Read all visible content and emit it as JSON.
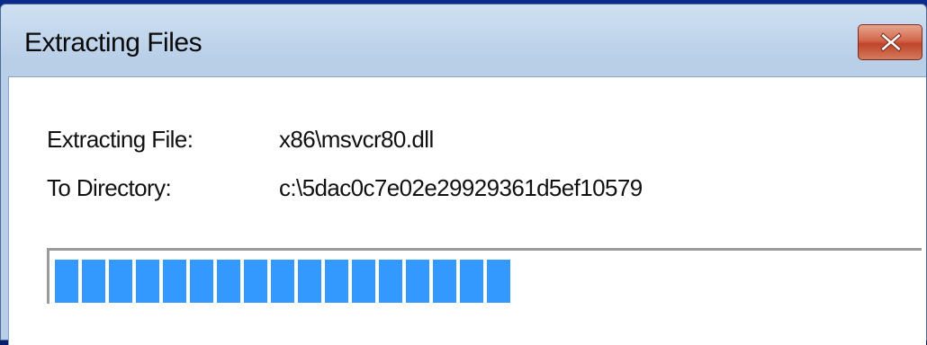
{
  "window": {
    "title": "Extracting Files",
    "close_icon": "close-icon"
  },
  "details": {
    "file_label": "Extracting File:",
    "file_value": "x86\\msvcr80.dll",
    "dir_label": "To Directory:",
    "dir_value": "c:\\5dac0c7e02e29929361d5ef10579"
  },
  "progress": {
    "percent": 53,
    "color": "#3399ff"
  },
  "colors": {
    "desktop": "#0b2a8c",
    "titlebar": "#b9cfe8",
    "close_button": "#c0452a"
  }
}
